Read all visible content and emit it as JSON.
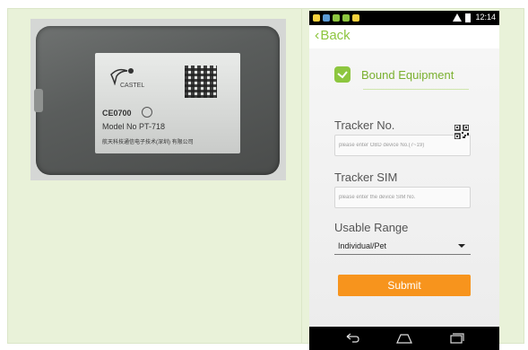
{
  "device_label": {
    "brand": "CASTEL",
    "ce_mark": "CE0700",
    "model": "Model No  PT-718",
    "company": "航天科技通信电子技术(深圳)  有限公司"
  },
  "status_bar": {
    "time": "12:14"
  },
  "app_bar": {
    "back_label": "Back"
  },
  "section": {
    "title": "Bound Equipment"
  },
  "form": {
    "tracker_no_label": "Tracker No.",
    "tracker_no_placeholder": "please enter OBD device No.(7~19)",
    "tracker_sim_label": "Tracker SIM",
    "tracker_sim_placeholder": "please enter the device SIM No.",
    "usable_range_label": "Usable Range",
    "usable_range_value": "Individual/Pet",
    "submit_label": "Submit"
  },
  "colors": {
    "accent_green": "#8dc63f",
    "submit_orange": "#f7941d",
    "panel_background": "#e9f2d9"
  },
  "icons": {
    "back": "chevron-left-icon",
    "section": "check-icon",
    "scan": "qr-code-icon",
    "dropdown": "caret-down-icon",
    "nav": [
      "back-nav-icon",
      "home-nav-icon",
      "recent-apps-icon"
    ]
  }
}
